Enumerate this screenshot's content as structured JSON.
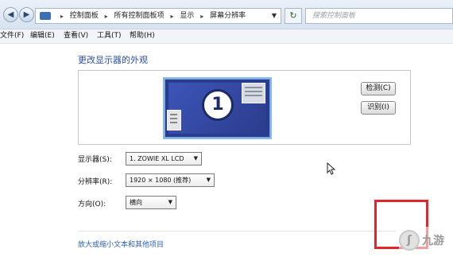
{
  "address_bar": {
    "breadcrumbs": [
      "控制面板",
      "所有控制面板项",
      "显示",
      "屏幕分辨率"
    ],
    "search_placeholder": "搜索控制面板"
  },
  "menu": {
    "items": [
      "文件(F)",
      "编辑(E)",
      "查看(V)",
      "工具(T)",
      "帮助(H)"
    ]
  },
  "page": {
    "title": "更改显示器的外观",
    "display_number": "1",
    "detect_button": "检测(C)",
    "identify_button": "识别(I)"
  },
  "settings": {
    "display": {
      "label": "显示器(S):",
      "value": "1. ZOWIE XL LCD"
    },
    "resolution": {
      "label": "分辨率(R):",
      "value": "1920 × 1080 (推荐)"
    },
    "orientation": {
      "label": "方向(O):",
      "value": "横向"
    }
  },
  "link": {
    "text": "放大或缩小文本和其他项目"
  },
  "watermark": {
    "text": "九游"
  },
  "colors": {
    "accent_title": "#2b4ea0",
    "link": "#2b63b5",
    "monitor_fill": "#2a3c8c",
    "annotation_red": "#e3262b"
  }
}
